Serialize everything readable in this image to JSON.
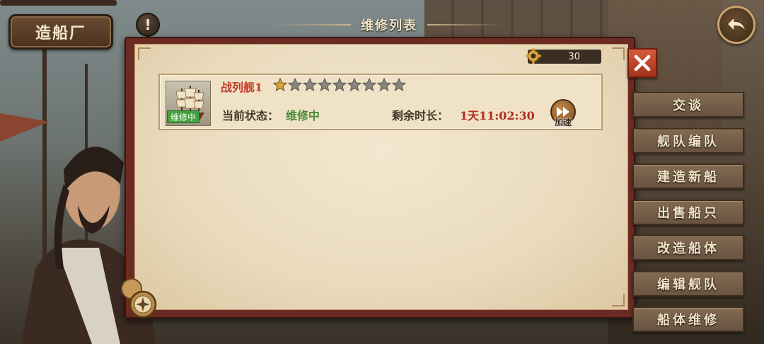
{
  "header": {
    "title": "造船厂",
    "help_label": "!",
    "dialog_title": "维修列表"
  },
  "resource": {
    "icon": "gear-icon",
    "value": "30"
  },
  "repair_list": [
    {
      "name": "战列舰1",
      "stars_filled": 1,
      "stars_total": 9,
      "tag": "维修中",
      "status_label": "当前状态：",
      "status_value": "维修中",
      "time_label": "剩余时长：",
      "time_value": "1天11:02:30",
      "speed_label": "加速"
    }
  ],
  "menu": {
    "items": [
      {
        "label": "交谈"
      },
      {
        "label": "舰队编队"
      },
      {
        "label": "建造新船"
      },
      {
        "label": "出售船只"
      },
      {
        "label": "改造船体"
      },
      {
        "label": "编辑舰队"
      },
      {
        "label": "船体维修"
      }
    ]
  },
  "colors": {
    "panel_frame": "#6b2a22",
    "paper": "#efe2c6",
    "ship_name": "#c43a2a",
    "status_green": "#4a8a3a",
    "time_red": "#b22a1a",
    "close_red": "#c64a2c",
    "menu_brown": "#765e49"
  }
}
